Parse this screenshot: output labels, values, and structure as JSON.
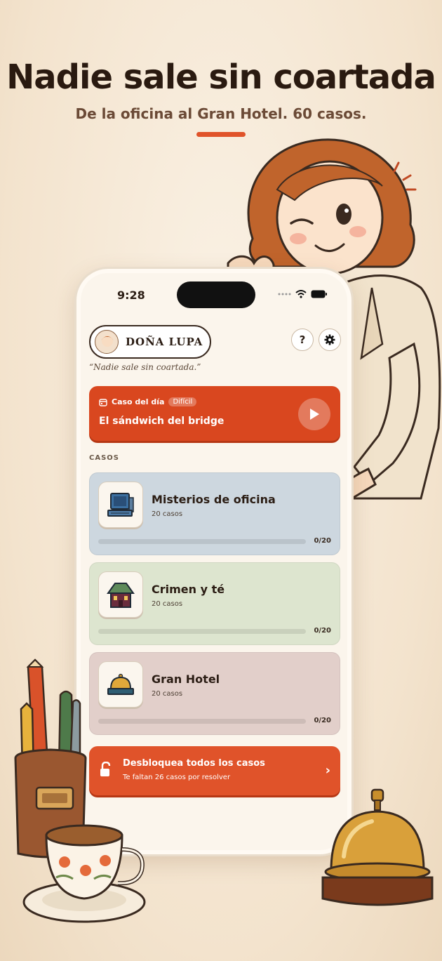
{
  "headline": "Nadie sale sin coartada",
  "subheadline": "De la oficina al Gran Hotel. 60 casos.",
  "status_bar": {
    "time": "9:28"
  },
  "app": {
    "brand": "DOÑA LUPA",
    "tagline": "“Nadie sale sin coartada.”",
    "help_label": "?",
    "daily": {
      "label": "Caso del día",
      "difficulty": "Difícil",
      "title": "El sándwich del bridge"
    },
    "section_label": "CASOS",
    "cases": [
      {
        "title": "Misterios de oficina",
        "count": "20 casos",
        "progress_text": "0/20",
        "progress": 0,
        "color": "#cdd7df",
        "icon": "computer-icon"
      },
      {
        "title": "Crimen y té",
        "count": "20 casos",
        "progress_text": "0/20",
        "progress": 0,
        "color": "#dde5cf",
        "icon": "house-icon"
      },
      {
        "title": "Gran Hotel",
        "count": "20 casos",
        "progress_text": "0/20",
        "progress": 0,
        "color": "#e2cfca",
        "icon": "bell-icon"
      }
    ],
    "unlock": {
      "title": "Desbloquea todos los casos",
      "subtitle": "Te faltan 26 casos por resolver"
    }
  },
  "colors": {
    "accent": "#d9471f",
    "background": "#f6ead9"
  }
}
